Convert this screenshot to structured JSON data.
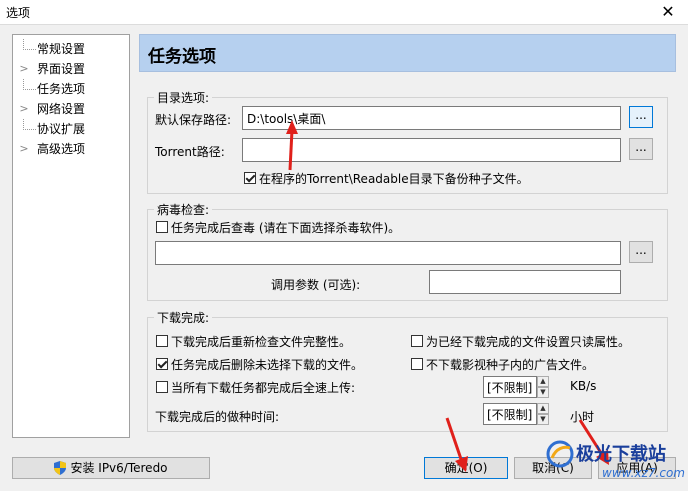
{
  "window": {
    "title": "选项",
    "close_glyph": "✕"
  },
  "tree": {
    "items": [
      {
        "label": "常规设置",
        "expandable": false
      },
      {
        "label": "界面设置",
        "expandable": true
      },
      {
        "label": "任务选项",
        "expandable": false
      },
      {
        "label": "网络设置",
        "expandable": true
      },
      {
        "label": "协议扩展",
        "expandable": false
      },
      {
        "label": "高级选项",
        "expandable": true
      }
    ]
  },
  "header": {
    "title": "任务选项"
  },
  "dir_group": {
    "title": "目录选项:",
    "save_path_label": "默认保存路径:",
    "save_path_value": "D:\\tools\\桌面\\",
    "torrent_label": "Torrent路径:",
    "torrent_value": "",
    "browse_label": "...",
    "backup_checkbox": {
      "label": "在程序的Torrent\\Readable目录下备份种子文件。",
      "checked": true
    }
  },
  "virus_group": {
    "title": "病毒检查:",
    "scan_checkbox": {
      "label": "任务完成后查毒 (请在下面选择杀毒软件)。",
      "checked": false
    },
    "program_value": "",
    "browse_label": "...",
    "params_label": "调用参数 (可选):",
    "params_value": ""
  },
  "complete_group": {
    "title": "下载完成:",
    "recheck": {
      "label": "下载完成后重新检查文件完整性。",
      "checked": false
    },
    "readonly": {
      "label": "为已经下载完成的文件设置只读属性。",
      "checked": false
    },
    "delete_unselected": {
      "label": "任务完成后删除未选择下载的文件。",
      "checked": true
    },
    "no_ads": {
      "label": "不下载影视种子内的广告文件。",
      "checked": false
    },
    "full_upload": {
      "label": "当所有下载任务都完成后全速上传:",
      "checked": false
    },
    "upload_value": "[不限制]",
    "upload_unit": "KB/s",
    "seed_time_label": "下载完成后的做种时间:",
    "seed_value": "[不限制]",
    "seed_unit": "小时"
  },
  "bottom": {
    "ipv6_button": "安装 IPv6/Teredo",
    "ok_button": "确定(O)",
    "cancel_button": "取消(C)",
    "apply_button": "应用(A)"
  },
  "watermark": {
    "text": "极光下载站",
    "url": "www.xz7.com"
  },
  "colors": {
    "header_bg": "#b6d0ef",
    "annotation_red": "#e0201b",
    "focus_blue": "#0078d7"
  }
}
